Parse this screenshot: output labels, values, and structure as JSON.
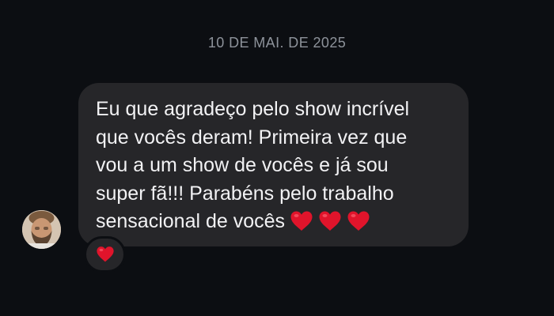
{
  "chat": {
    "date_separator": "10 DE MAI. DE 2025",
    "message": {
      "text": "Eu que agradeço pelo show incrível\nque vocês deram! Primeira vez que\nvou a um show de vocês e já sou\nsuper fã!!! Parabéns pelo trabalho\nsensacional de vocês",
      "emojis": [
        "heart-icon",
        "heart-icon",
        "heart-icon"
      ],
      "bubble_color": "#262629"
    },
    "reaction": {
      "emoji": "heart-icon",
      "color": "#e0142b"
    },
    "sender": {
      "avatar": "profile-photo"
    }
  },
  "theme": {
    "background": "#0c0e12",
    "text_color": "#f2f2f4",
    "muted_color": "#8d929a"
  }
}
